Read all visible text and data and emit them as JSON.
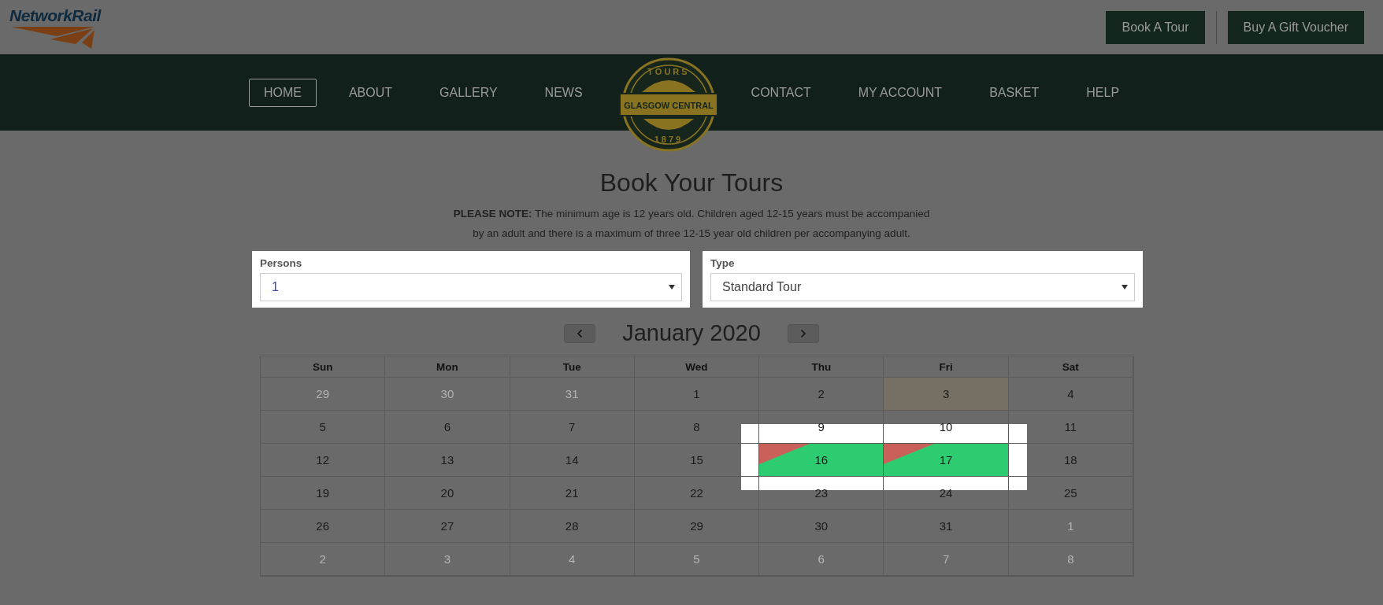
{
  "brand": {
    "name": "NetworkRail"
  },
  "header_buttons": [
    "Book A Tour",
    "Buy A Gift Voucher"
  ],
  "nav_left": [
    {
      "label": "HOME",
      "selected": true
    },
    {
      "label": "ABOUT",
      "selected": false
    },
    {
      "label": "GALLERY",
      "selected": false
    },
    {
      "label": "NEWS",
      "selected": false
    }
  ],
  "badge": {
    "top": "TOURS",
    "name": "GLASGOW CENTRAL",
    "year": "1879"
  },
  "nav_right": [
    {
      "label": "CONTACT",
      "selected": false
    },
    {
      "label": "MY ACCOUNT",
      "selected": false
    },
    {
      "label": "BASKET",
      "selected": false
    },
    {
      "label": "HELP",
      "selected": false
    }
  ],
  "title": "Book Your Tours",
  "note": [
    "**PLEASE NOTE:** The minimum age is 12 years old. Children aged 12-15 years must be accompanied",
    "by an adult and there is a maximum of three 12-15 year old children per accompanying adult."
  ],
  "fields": [
    {
      "label": "Persons",
      "value": "1"
    },
    {
      "label": "Type",
      "value": "Standard Tour"
    }
  ],
  "calendar": {
    "month": "January 2020",
    "weekdays": [
      "Sun",
      "Mon",
      "Tue",
      "Wed",
      "Thu",
      "Fri",
      "Sat"
    ],
    "weeks": [
      [
        {
          "day": "29",
          "kind": "outside"
        },
        {
          "day": "30",
          "kind": "outside"
        },
        {
          "day": "31",
          "kind": "outside"
        },
        {
          "day": "1",
          "kind": "day"
        },
        {
          "day": "2",
          "kind": "day"
        },
        {
          "day": "3",
          "kind": "today"
        },
        {
          "day": "4",
          "kind": "day"
        }
      ],
      [
        {
          "day": "5",
          "kind": "day"
        },
        {
          "day": "6",
          "kind": "day"
        },
        {
          "day": "7",
          "kind": "day"
        },
        {
          "day": "8",
          "kind": "day"
        },
        {
          "day": "9",
          "kind": "day"
        },
        {
          "day": "10",
          "kind": "day"
        },
        {
          "day": "11",
          "kind": "day"
        }
      ],
      [
        {
          "day": "12",
          "kind": "day"
        },
        {
          "day": "13",
          "kind": "day"
        },
        {
          "day": "14",
          "kind": "day"
        },
        {
          "day": "15",
          "kind": "day"
        },
        {
          "day": "16",
          "kind": "available"
        },
        {
          "day": "17",
          "kind": "available"
        },
        {
          "day": "18",
          "kind": "day"
        }
      ],
      [
        {
          "day": "19",
          "kind": "day"
        },
        {
          "day": "20",
          "kind": "day"
        },
        {
          "day": "21",
          "kind": "day"
        },
        {
          "day": "22",
          "kind": "day"
        },
        {
          "day": "23",
          "kind": "day"
        },
        {
          "day": "24",
          "kind": "day"
        },
        {
          "day": "25",
          "kind": "day"
        }
      ],
      [
        {
          "day": "26",
          "kind": "day"
        },
        {
          "day": "27",
          "kind": "day"
        },
        {
          "day": "28",
          "kind": "day"
        },
        {
          "day": "29",
          "kind": "day"
        },
        {
          "day": "30",
          "kind": "day"
        },
        {
          "day": "31",
          "kind": "day"
        },
        {
          "day": "1",
          "kind": "outside"
        }
      ],
      [
        {
          "day": "2",
          "kind": "outside"
        },
        {
          "day": "3",
          "kind": "outside"
        },
        {
          "day": "4",
          "kind": "outside"
        },
        {
          "day": "5",
          "kind": "outside"
        },
        {
          "day": "6",
          "kind": "outside"
        },
        {
          "day": "7",
          "kind": "outside"
        },
        {
          "day": "8",
          "kind": "outside"
        }
      ]
    ]
  }
}
